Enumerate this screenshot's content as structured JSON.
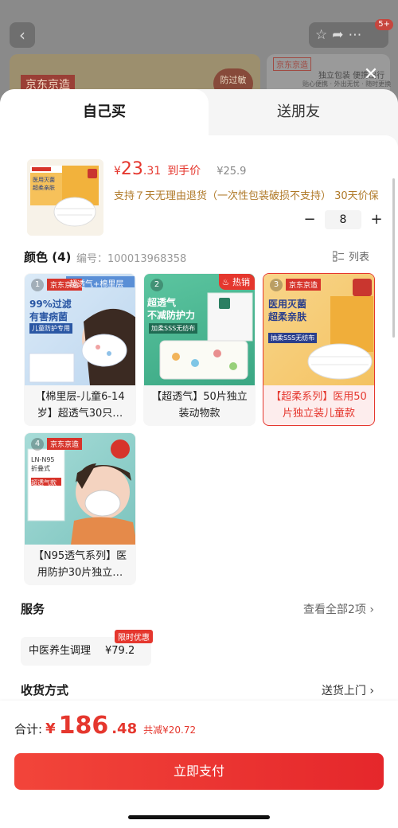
{
  "background_page": {
    "logo_text": "京东京造",
    "tag_text": "防过敏",
    "side_logo": "京东京造",
    "side_text": "独立包装 便携出行",
    "side_sub": "贴心便携 · 外出无忧 · 随时更换"
  },
  "header_badge": "5+",
  "tabs": {
    "self": "自己买",
    "friend": "送朋友"
  },
  "product": {
    "currency": "¥",
    "price_int": "23",
    "price_dec": ".31",
    "price_label": "到手价",
    "original_price": "¥25.9",
    "return_policy": "支持７天无理由退货（一次性包装破损不支持） 30天价保",
    "quantity": "8",
    "minus": "−",
    "plus": "+"
  },
  "color": {
    "title": "颜色 (4)",
    "code": "编号：100013968358",
    "list_label": "列表",
    "variants": [
      {
        "num": "1",
        "label": "【棉里层-儿童6-14岁】超透气30只…",
        "img_text": "99%过滤\n有害病菌",
        "img_top": "超透气+棉里层",
        "img_banner": "儿童防护专用"
      },
      {
        "num": "2",
        "label": "【超透气】50片独立装动物款",
        "img_text": "超透气\n不减防护力",
        "img_banner": "加柔SSS无纺布",
        "hot": "热销"
      },
      {
        "num": "3",
        "label": "【超柔系列】医用50片独立装儿童款",
        "img_text": "医用灭菌\n超柔亲肤",
        "img_banner": "抽柔SSS无纺布"
      },
      {
        "num": "4",
        "label": "【N95透气系列】医用防护30片独立…",
        "img_text": "LN-N95\n折叠式",
        "img_banner": "超透气款"
      }
    ]
  },
  "service": {
    "title": "服务",
    "view_all": "查看全部2项",
    "item_name": "中医养生调理",
    "item_price": "¥79.2",
    "limit_tag": "限时优惠"
  },
  "delivery": {
    "title": "收货方式",
    "value": "送货上门"
  },
  "footer": {
    "total_label": "合计:",
    "currency": "¥",
    "total_int": "186",
    "total_dec": ".48",
    "saving": "共减¥20.72",
    "pay_button": "立即支付"
  },
  "logo_chip": "京东京造",
  "colors": {
    "accent": "#e5372e",
    "pay_start": "#f2453a",
    "pay_end": "#e5272b",
    "gold_text": "#b07a29"
  },
  "icons": [
    "back-icon",
    "star-icon",
    "share-icon",
    "more-icon",
    "close-icon",
    "list-icon",
    "chevron-right-icon",
    "fire-icon"
  ]
}
